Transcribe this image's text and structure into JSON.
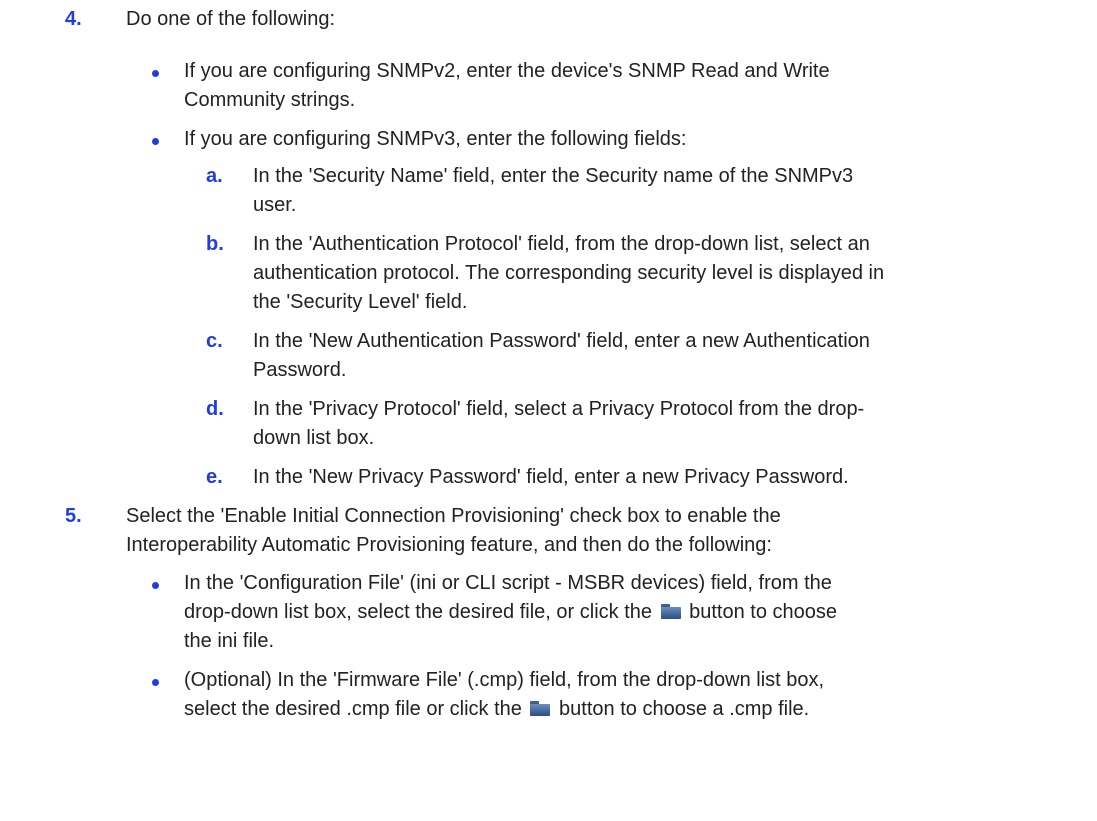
{
  "steps": {
    "step4": {
      "number": "4.",
      "text": "Do one of the following:",
      "bullet1": {
        "line1": "If you are configuring SNMPv2, enter the device's SNMP Read and Write",
        "line2": "Community strings."
      },
      "bullet2": {
        "text": "If you are configuring SNMPv3, enter the following fields:",
        "items": [
          {
            "letter": "a.",
            "line1": "In the 'Security Name' field, enter the Security name of the SNMPv3",
            "line2": "user."
          },
          {
            "letter": "b.",
            "line1": "In the 'Authentication Protocol' field, from the drop-down list, select an",
            "line2": "authentication protocol. The corresponding security level is displayed in",
            "line3": "the 'Security Level' field."
          },
          {
            "letter": "c.",
            "line1": "In the 'New Authentication Password' field, enter a new Authentication",
            "line2": "Password."
          },
          {
            "letter": "d.",
            "line1": "In the 'Privacy Protocol' field, select a Privacy Protocol from the drop-",
            "line2": "down list box."
          },
          {
            "letter": "e.",
            "line1": "In the 'New Privacy Password' field, enter a new Privacy Password."
          }
        ]
      }
    },
    "step5": {
      "number": "5.",
      "line1": "Select the 'Enable Initial Connection Provisioning' check box to enable the",
      "line2": "Interoperability Automatic Provisioning feature, and then do the following:",
      "bullet1": {
        "line1": "In the 'Configuration File' (ini or CLI script - MSBR devices) field, from the",
        "line2_before": "drop-down list box, select the desired file, or click the",
        "line2_after": "button to choose",
        "line3": "the ini file.",
        "icon": "folder-icon"
      },
      "bullet2": {
        "line1": "(Optional) In the 'Firmware File' (.cmp) field, from the drop-down list box,",
        "line2_before": "select the desired .cmp file or click the",
        "line2_after": "button to choose a .cmp file.",
        "icon": "folder-icon"
      }
    }
  },
  "colors": {
    "accent": "#1f3de0",
    "text": "#222222"
  }
}
